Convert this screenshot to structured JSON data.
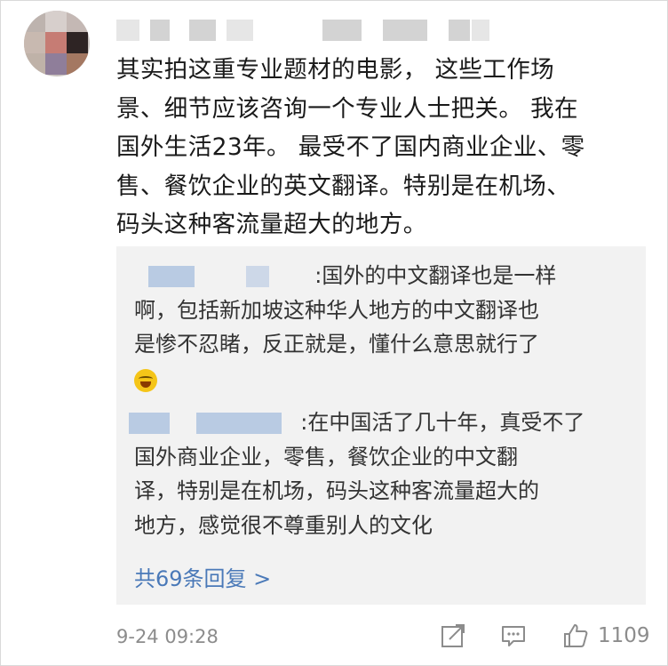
{
  "comment": {
    "lines": [
      "其实拍这重专业题材的电影， 这些工作场",
      "景、细节应该咨询一个专业人士把关。 我在",
      "国外生活23年。 最受不了国内商业企业、零",
      "售、餐饮企业的英文翻译。特别是在机场、",
      "码头这种客流量超大的地方。"
    ],
    "time": "9-24 09:28",
    "like_count": "1109"
  },
  "replies": [
    {
      "lines": [
        ":国外的中文翻译也是一样",
        "啊，包括新加坡这种华人地方的中文翻译也",
        "是惨不忍睹，反正就是，懂什么意思就行了"
      ],
      "emoji": "laugh-cry-emoji"
    },
    {
      "lines": [
        ":在中国活了几十年，真受不了",
        "国外商业企业，零售，餐饮企业的中文翻",
        "译，特别是在机场，码头这种客流量超大的",
        "地方，感觉很不尊重别人的文化"
      ]
    }
  ],
  "more_replies": "共69条回复 >",
  "icons": [
    "share-icon",
    "comment-icon",
    "like-icon"
  ],
  "colors": {
    "link": "#4a79b8",
    "reply_bg": "#f2f2f2",
    "meta": "#8c8c8c"
  }
}
